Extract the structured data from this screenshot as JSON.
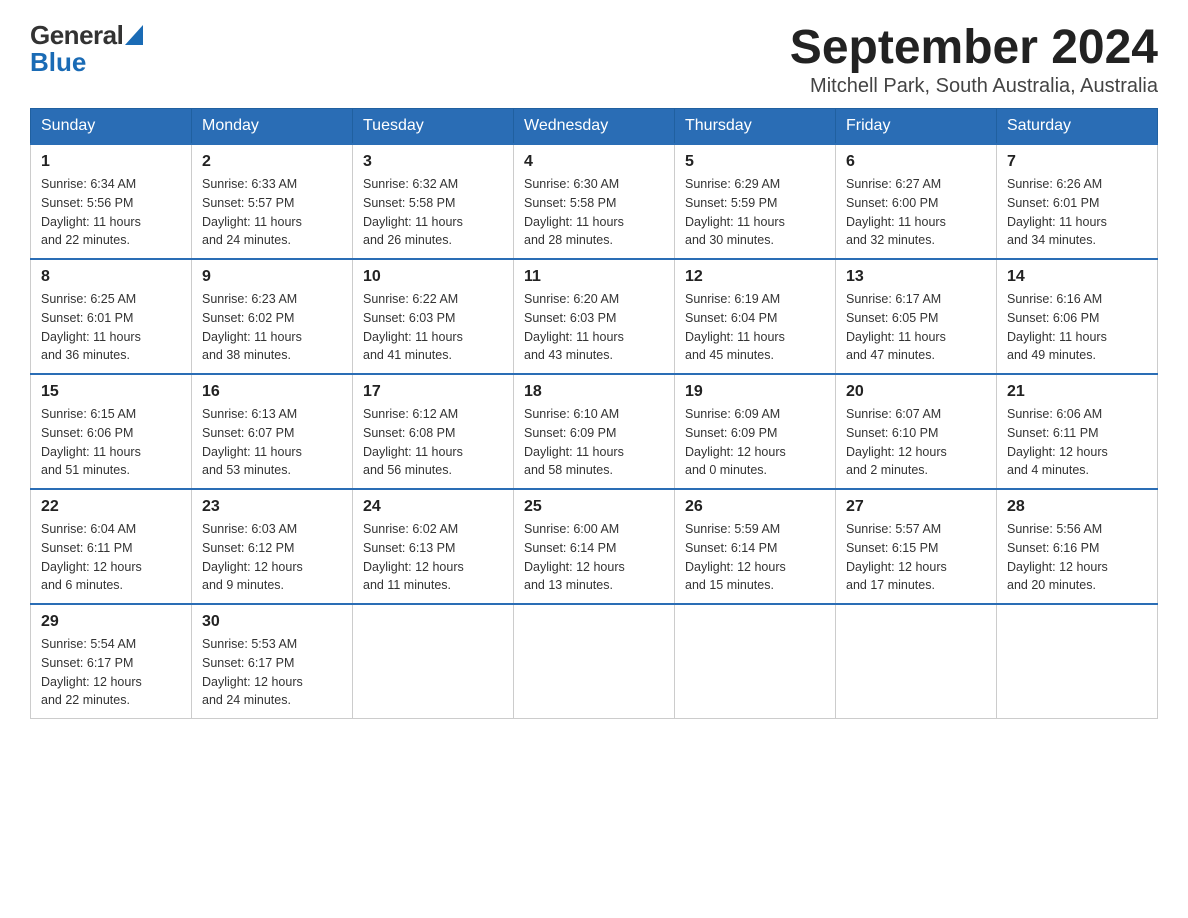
{
  "header": {
    "logo_general": "General",
    "logo_blue": "Blue",
    "month_year": "September 2024",
    "location": "Mitchell Park, South Australia, Australia"
  },
  "weekdays": [
    "Sunday",
    "Monday",
    "Tuesday",
    "Wednesday",
    "Thursday",
    "Friday",
    "Saturday"
  ],
  "weeks": [
    [
      {
        "day": "1",
        "sunrise": "6:34 AM",
        "sunset": "5:56 PM",
        "daylight": "11 hours and 22 minutes."
      },
      {
        "day": "2",
        "sunrise": "6:33 AM",
        "sunset": "5:57 PM",
        "daylight": "11 hours and 24 minutes."
      },
      {
        "day": "3",
        "sunrise": "6:32 AM",
        "sunset": "5:58 PM",
        "daylight": "11 hours and 26 minutes."
      },
      {
        "day": "4",
        "sunrise": "6:30 AM",
        "sunset": "5:58 PM",
        "daylight": "11 hours and 28 minutes."
      },
      {
        "day": "5",
        "sunrise": "6:29 AM",
        "sunset": "5:59 PM",
        "daylight": "11 hours and 30 minutes."
      },
      {
        "day": "6",
        "sunrise": "6:27 AM",
        "sunset": "6:00 PM",
        "daylight": "11 hours and 32 minutes."
      },
      {
        "day": "7",
        "sunrise": "6:26 AM",
        "sunset": "6:01 PM",
        "daylight": "11 hours and 34 minutes."
      }
    ],
    [
      {
        "day": "8",
        "sunrise": "6:25 AM",
        "sunset": "6:01 PM",
        "daylight": "11 hours and 36 minutes."
      },
      {
        "day": "9",
        "sunrise": "6:23 AM",
        "sunset": "6:02 PM",
        "daylight": "11 hours and 38 minutes."
      },
      {
        "day": "10",
        "sunrise": "6:22 AM",
        "sunset": "6:03 PM",
        "daylight": "11 hours and 41 minutes."
      },
      {
        "day": "11",
        "sunrise": "6:20 AM",
        "sunset": "6:03 PM",
        "daylight": "11 hours and 43 minutes."
      },
      {
        "day": "12",
        "sunrise": "6:19 AM",
        "sunset": "6:04 PM",
        "daylight": "11 hours and 45 minutes."
      },
      {
        "day": "13",
        "sunrise": "6:17 AM",
        "sunset": "6:05 PM",
        "daylight": "11 hours and 47 minutes."
      },
      {
        "day": "14",
        "sunrise": "6:16 AM",
        "sunset": "6:06 PM",
        "daylight": "11 hours and 49 minutes."
      }
    ],
    [
      {
        "day": "15",
        "sunrise": "6:15 AM",
        "sunset": "6:06 PM",
        "daylight": "11 hours and 51 minutes."
      },
      {
        "day": "16",
        "sunrise": "6:13 AM",
        "sunset": "6:07 PM",
        "daylight": "11 hours and 53 minutes."
      },
      {
        "day": "17",
        "sunrise": "6:12 AM",
        "sunset": "6:08 PM",
        "daylight": "11 hours and 56 minutes."
      },
      {
        "day": "18",
        "sunrise": "6:10 AM",
        "sunset": "6:09 PM",
        "daylight": "11 hours and 58 minutes."
      },
      {
        "day": "19",
        "sunrise": "6:09 AM",
        "sunset": "6:09 PM",
        "daylight": "12 hours and 0 minutes."
      },
      {
        "day": "20",
        "sunrise": "6:07 AM",
        "sunset": "6:10 PM",
        "daylight": "12 hours and 2 minutes."
      },
      {
        "day": "21",
        "sunrise": "6:06 AM",
        "sunset": "6:11 PM",
        "daylight": "12 hours and 4 minutes."
      }
    ],
    [
      {
        "day": "22",
        "sunrise": "6:04 AM",
        "sunset": "6:11 PM",
        "daylight": "12 hours and 6 minutes."
      },
      {
        "day": "23",
        "sunrise": "6:03 AM",
        "sunset": "6:12 PM",
        "daylight": "12 hours and 9 minutes."
      },
      {
        "day": "24",
        "sunrise": "6:02 AM",
        "sunset": "6:13 PM",
        "daylight": "12 hours and 11 minutes."
      },
      {
        "day": "25",
        "sunrise": "6:00 AM",
        "sunset": "6:14 PM",
        "daylight": "12 hours and 13 minutes."
      },
      {
        "day": "26",
        "sunrise": "5:59 AM",
        "sunset": "6:14 PM",
        "daylight": "12 hours and 15 minutes."
      },
      {
        "day": "27",
        "sunrise": "5:57 AM",
        "sunset": "6:15 PM",
        "daylight": "12 hours and 17 minutes."
      },
      {
        "day": "28",
        "sunrise": "5:56 AM",
        "sunset": "6:16 PM",
        "daylight": "12 hours and 20 minutes."
      }
    ],
    [
      {
        "day": "29",
        "sunrise": "5:54 AM",
        "sunset": "6:17 PM",
        "daylight": "12 hours and 22 minutes."
      },
      {
        "day": "30",
        "sunrise": "5:53 AM",
        "sunset": "6:17 PM",
        "daylight": "12 hours and 24 minutes."
      },
      null,
      null,
      null,
      null,
      null
    ]
  ],
  "labels": {
    "sunrise": "Sunrise: ",
    "sunset": "Sunset: ",
    "daylight": "Daylight: "
  }
}
